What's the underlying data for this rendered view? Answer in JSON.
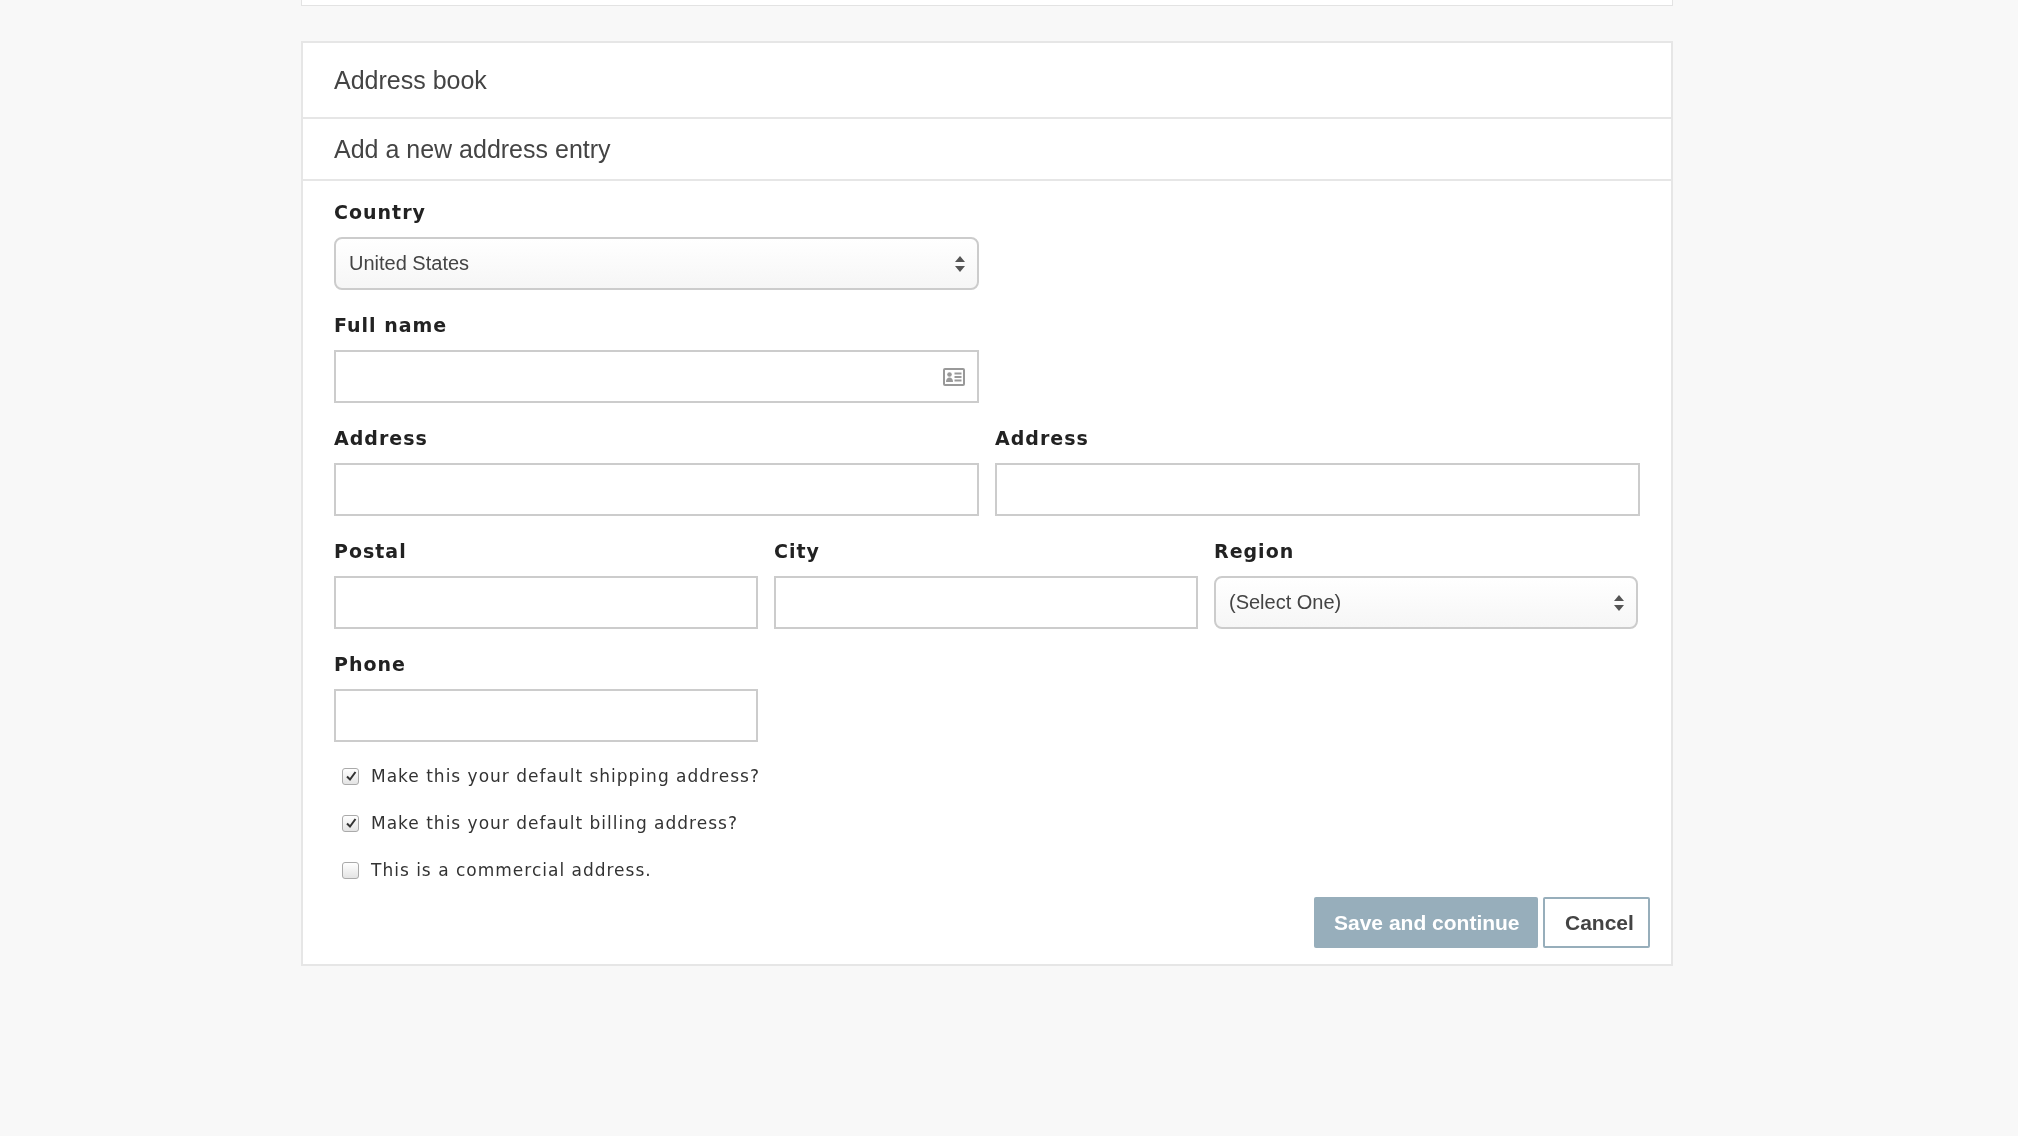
{
  "panel": {
    "title": "Address book",
    "subtitle": "Add a new address entry"
  },
  "form_rows": [
    [
      {
        "label": "Country",
        "kind": "select",
        "value": "United States"
      }
    ],
    [
      {
        "label": "Full name",
        "kind": "contact"
      }
    ],
    [
      {
        "label": "Address",
        "kind": "text"
      },
      {
        "label": "Address",
        "kind": "text"
      }
    ],
    [
      {
        "label": "Postal",
        "kind": "text"
      },
      {
        "label": "City",
        "kind": "text"
      },
      {
        "label": "Region",
        "kind": "select",
        "value": "(Select One)"
      }
    ],
    [
      {
        "label": "Phone",
        "kind": "text"
      }
    ]
  ],
  "checkboxes": [
    {
      "label": "Make this your default shipping address?",
      "checked": true
    },
    {
      "label": "Make this your default billing address?",
      "checked": true
    },
    {
      "label": "This is a commercial address.",
      "checked": false
    }
  ],
  "buttons": [
    {
      "label": "Save and continue",
      "kind": "primary"
    },
    {
      "label": "Cancel",
      "kind": "secondary"
    }
  ]
}
